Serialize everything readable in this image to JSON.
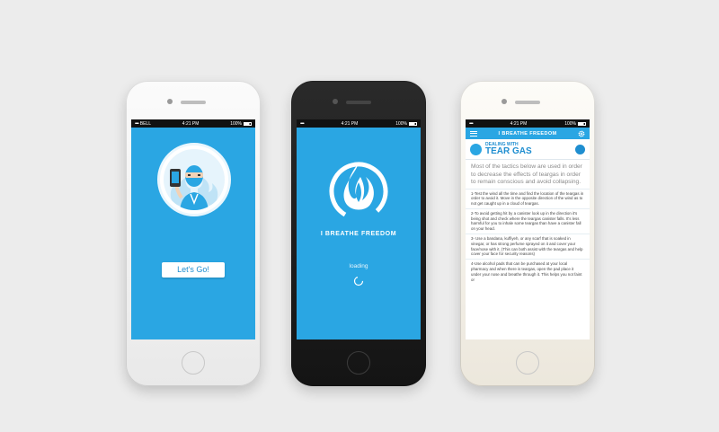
{
  "colors": {
    "accent": "#2aa6e3",
    "accent_dark": "#1f8ed0",
    "background": "#ececec"
  },
  "status_bar": {
    "carrier": "BELL",
    "time": "4:21 PM",
    "battery": "100%",
    "signal_dots": "•••••"
  },
  "phone1": {
    "button_label": "Let's Go!",
    "illustration": "masked-person-holding-phone"
  },
  "phone2": {
    "app_name": "I BREATHE FREEDOM",
    "loading_text": "loading",
    "logo_icon": "flame-logo-icon"
  },
  "phone3": {
    "app_bar_title": "I BREATHE FREEDOM",
    "header_small": "DEALING WITH",
    "header_big": "TEAR GAS",
    "intro": "Most of the tactics below are used in order to decrease the effects of teargas in order to remain conscious and avoid collapsing.",
    "tips": [
      "1-Test the wind all the time and find the location of the teargas in order to avoid it. Move in the opposite direction of the wind as to not get caught up in a cloud of teargas.",
      "2-To avoid getting hit by a canister look up in the direction it's being shot and check where the teargas canister falls. It's less harmful for you to inhale some teargas than have a canister fall on your head.",
      "3- Use a bandana, kuffiyeh, or any scarf that is soaked in vinegar, or has strong perfume sprayed on it and cover your face/nose with it. (This can both assist with the teargas and help cover your face for security reasons)",
      "4-Use alcohol pads that can be purchased at your local pharmacy and when there is teargas, open the pad place it under your nose and breathe through it. This helps you not faint or"
    ]
  }
}
